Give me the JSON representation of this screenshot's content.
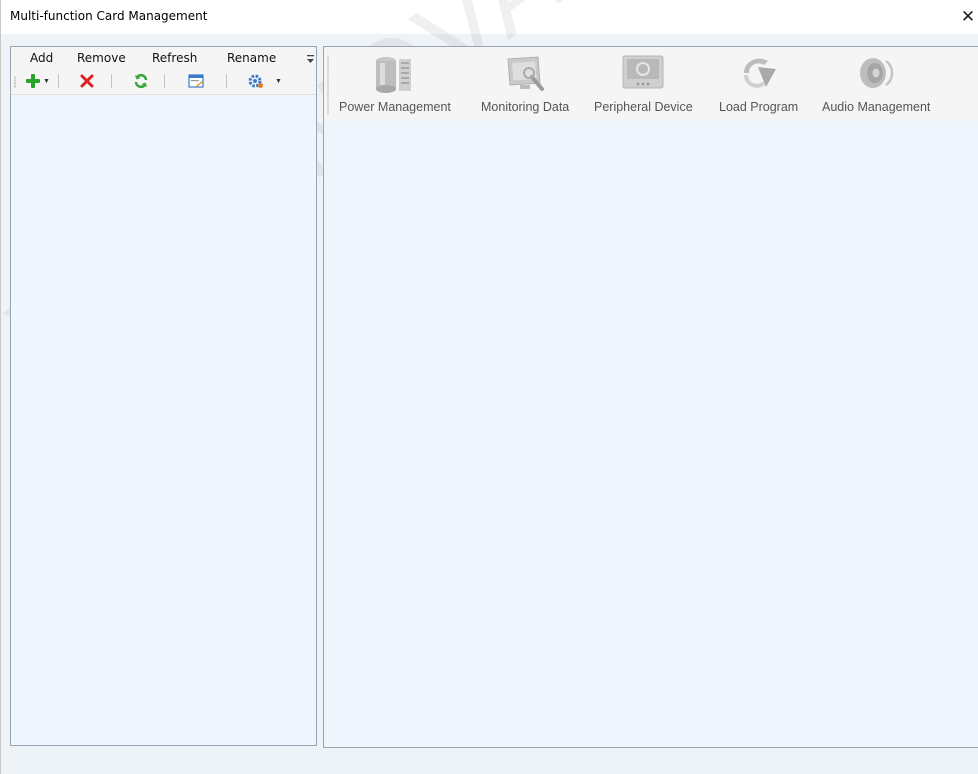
{
  "window": {
    "title": "Multi-function Card Management",
    "close_label": "✕"
  },
  "left_panel": {
    "menu": [
      {
        "label": "Add"
      },
      {
        "label": "Remove"
      },
      {
        "label": "Refresh"
      },
      {
        "label": "Rename"
      }
    ],
    "toolbar": [
      {
        "icon": "add-icon",
        "has_dropdown": true
      },
      {
        "icon": "delete-icon"
      },
      {
        "icon": "refresh-icon"
      },
      {
        "icon": "rename-icon"
      },
      {
        "icon": "settings-icon",
        "has_dropdown": true
      }
    ]
  },
  "right_panel": {
    "toolbar": [
      {
        "label": "Power Management",
        "icon": "power-management-icon"
      },
      {
        "label": "Monitoring Data",
        "icon": "monitoring-data-icon"
      },
      {
        "label": "Peripheral Device",
        "icon": "peripheral-device-icon"
      },
      {
        "label": "Load Program",
        "icon": "load-program-icon"
      },
      {
        "label": "Audio Management",
        "icon": "audio-management-icon"
      }
    ]
  },
  "watermark": "XI'AN NOVASTAR",
  "colors": {
    "panel_bg": "#eef5fc",
    "add_green": "#2aa52a",
    "delete_red": "#e02020"
  }
}
